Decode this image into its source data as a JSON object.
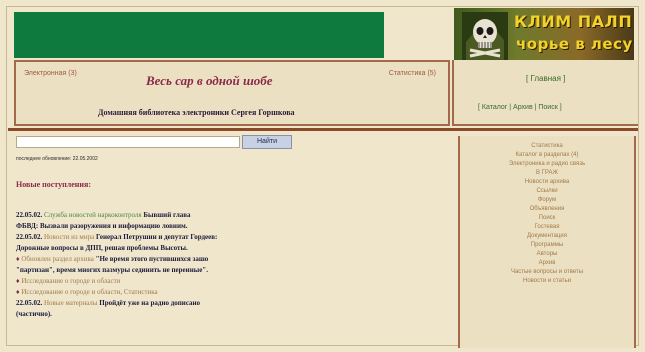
{
  "logo": {
    "line1": "КЛИМ ПАЛП",
    "line2": "чорье в лесу",
    "icon": "skull-icon"
  },
  "header": {
    "left_link": "Электронная (3)",
    "right_link": "Статистика (5)",
    "title": "Весь сар в одной шобе",
    "subtitle": "Домашняя библиотека электроники Сергея Горшкова"
  },
  "right_top": {
    "main_link": "[ Главная ]",
    "sub_links": "[ Каталог | Архив | Поиск ]"
  },
  "search": {
    "value": "",
    "button_label": "Найти"
  },
  "last_update": "последнее обновление: 22.05.2002",
  "news_heading": "Новые поступления:",
  "news": [
    {
      "date": "22.05.02.",
      "link": "Служба новостей наркоконтроля",
      "link_style": "green",
      "text": " Бывший глава"
    },
    {
      "date": "",
      "link": "",
      "link_style": "",
      "text": "ФБВД: Вызвали разоружения и информацию ловним."
    },
    {
      "date": "22.05.02.",
      "link": "Новости из мира",
      "link_style": "brown",
      "text": " Генерал Петрушин и депутат Гордеев:"
    },
    {
      "date": "",
      "link": "",
      "link_style": "",
      "text": "Дорожные вопросы в ДПП, решая проблемы Высоты."
    },
    {
      "bullet": "♦",
      "date": "",
      "link": "Обновлен раздел архива",
      "link_style": "brown",
      "text": " \"Не время этого пустившихся зашо"
    },
    {
      "date": "",
      "link": "",
      "link_style": "",
      "text": "\"партизан\", время многих пазмуры сединить не переиные\"."
    },
    {
      "bullet": "♦",
      "date": "",
      "link": "Исследование о городе и области",
      "link_style": "brown",
      "text": ""
    },
    {
      "bullet": "♦",
      "date": "",
      "link": "Исследование о городе и области, Статистика",
      "link_style": "brown",
      "text": ""
    },
    {
      "date": "22.05.02.",
      "link": "Новые материалы",
      "link_style": "brown",
      "text": " Пройдёт уже на радио дописано"
    },
    {
      "date": "",
      "link": "",
      "link_style": "",
      "text": "(частично)."
    }
  ],
  "sidebar": {
    "items": [
      "Статистика",
      "Каталог в разделах (4)",
      "Электроника и радио связь",
      "В ГРАЖ",
      "Новости архива",
      "Ссылки",
      "Форум",
      "Объявления",
      "Поиск",
      "Гостевая",
      "Документация",
      "Программы",
      "Авторы",
      "Архив",
      "Частые вопросы и ответы",
      "Новости и статьи"
    ]
  },
  "colors": {
    "banner": "#0f7a3e",
    "background": "#efe6cc",
    "border": "#a26a4a",
    "title": "#8a2a4a",
    "link_green": "#4a8a3a"
  }
}
